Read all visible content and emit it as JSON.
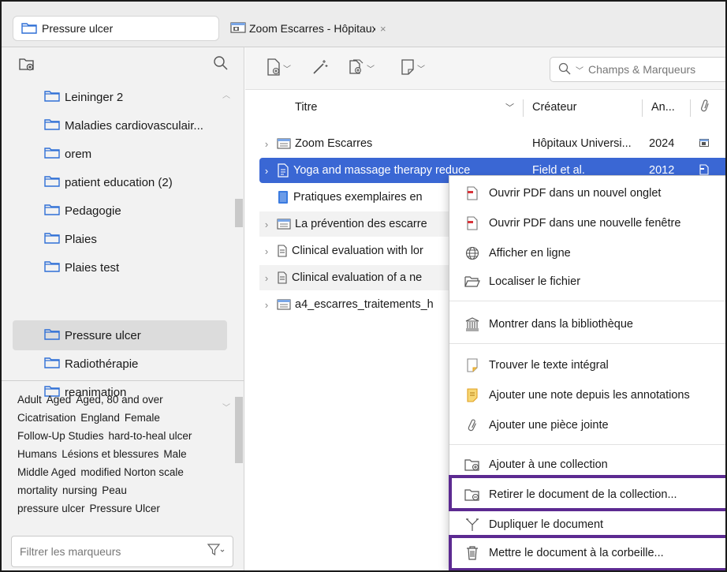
{
  "tabs": {
    "active": {
      "title": "Pressure ulcer"
    },
    "inactive": {
      "title": "Zoom Escarres - Hôpitaux Universitaires",
      "close": "×"
    }
  },
  "collections": [
    {
      "label": "Leininger 2"
    },
    {
      "label": "Maladies cardiovasculair..."
    },
    {
      "label": "orem"
    },
    {
      "label": "patient education (2)"
    },
    {
      "label": "Pedagogie"
    },
    {
      "label": "Plaies"
    },
    {
      "label": "Plaies test"
    },
    {
      "label": "Pressure ulcer",
      "selected": true
    },
    {
      "label": "Radiothérapie"
    },
    {
      "label": "reanimation"
    }
  ],
  "tags": [
    "Adult",
    "Aged",
    "Aged, 80 and over",
    "Cicatrisation",
    "England",
    "Female",
    "Follow-Up Studies",
    "hard-to-heal ulcer",
    "Humans",
    "Lésions et blessures",
    "Male",
    "Middle Aged",
    "modified Norton scale",
    "mortality",
    "nursing",
    "Peau",
    "pressure ulcer",
    "Pressure Ulcer"
  ],
  "tag_filter": {
    "placeholder": "Filtrer les marqueurs"
  },
  "search": {
    "placeholder": "Champs & Marqueurs"
  },
  "columns": {
    "title": "Titre",
    "creator": "Créateur",
    "year": "An..."
  },
  "items": [
    {
      "title": "Zoom Escarres",
      "creator": "Hôpitaux Universi...",
      "year": "2024",
      "type": "webpage",
      "twisty": "›",
      "alt": false
    },
    {
      "title": "Yoga and massage therapy reduce",
      "creator": "Field et al.",
      "year": "2012",
      "type": "article",
      "twisty": "›",
      "selected": true
    },
    {
      "title": "Pratiques exemplaires en",
      "creator": "",
      "year": "",
      "type": "book",
      "twisty": "",
      "alt": false
    },
    {
      "title": "La prévention des escarre",
      "creator": "",
      "year": "",
      "type": "webpage",
      "twisty": "›",
      "alt": true
    },
    {
      "title": "Clinical evaluation with lor",
      "creator": "",
      "year": "",
      "type": "article",
      "twisty": "›",
      "alt": false
    },
    {
      "title": "Clinical evaluation of a ne",
      "creator": "",
      "year": "",
      "type": "article",
      "twisty": "›",
      "alt": true
    },
    {
      "title": "a4_escarres_traitements_h",
      "creator": "",
      "year": "",
      "type": "webpage",
      "twisty": "›",
      "alt": false
    }
  ],
  "context_menu": {
    "open_pdf_tab": "Ouvrir PDF dans un nouvel onglet",
    "open_pdf_window": "Ouvrir PDF dans une nouvelle fenêtre",
    "view_online": "Afficher en ligne",
    "locate_file": "Localiser le fichier",
    "show_in_library": "Montrer dans la bibliothèque",
    "find_fulltext": "Trouver le texte intégral",
    "add_note_annotations": "Ajouter une note depuis les annotations",
    "add_attachment": "Ajouter une pièce jointe",
    "add_to_collection": "Ajouter à une collection",
    "remove_from_collection": "Retirer le document de la collection...",
    "duplicate": "Dupliquer le document",
    "move_to_trash": "Mettre le document à la corbeille..."
  },
  "colors": {
    "selection": "#3a67d4",
    "highlight_box": "#5c2a91",
    "folder": "#2f6fd6"
  }
}
